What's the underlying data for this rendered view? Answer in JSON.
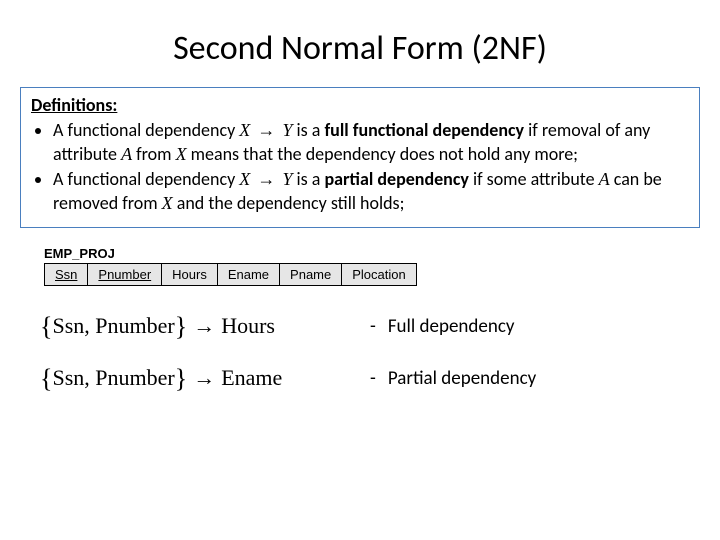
{
  "title": "Second Normal Form (2NF)",
  "definitions": {
    "heading": "Definitions:",
    "item1_pre": "A functional dependency ",
    "var_X": "X",
    "arrow": "→",
    "var_Y": "Y",
    "item1_mid": " is a ",
    "item1_bold": "full functional dependency",
    "item1_post": " if removal of any attribute ",
    "var_A": "A",
    "item1_post2": " from ",
    "item1_post3": " means that the dependency does not hold any more;",
    "item2_pre": "A functional dependency ",
    "item2_mid": " is a ",
    "item2_bold": "partial dependency",
    "item2_post": " if some attribute ",
    "item2_post2": " can be removed from ",
    "item2_post3": " and the dependency still holds;"
  },
  "relation": {
    "name": "EMP_PROJ",
    "cols": [
      "Ssn",
      "Pnumber",
      "Hours",
      "Ename",
      "Pname",
      "Plocation"
    ]
  },
  "dep1": {
    "lhs1": "Ssn",
    "lhs2": "Pnumber",
    "rhs": "Hours",
    "label": "Full dependency"
  },
  "dep2": {
    "lhs1": "Ssn",
    "lhs2": "Pnumber",
    "rhs": "Ename",
    "label": "Partial dependency"
  },
  "glyphs": {
    "lbrace": "{",
    "rbrace": "}",
    "comma": ", ",
    "dash": "-"
  }
}
